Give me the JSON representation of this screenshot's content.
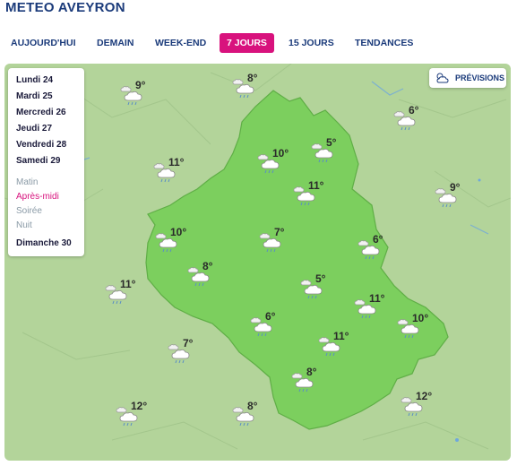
{
  "title": "METEO AVEYRON",
  "tabs": [
    {
      "label": "AUJOURD'HUI",
      "active": false
    },
    {
      "label": "DEMAIN",
      "active": false
    },
    {
      "label": "WEEK-END",
      "active": false
    },
    {
      "label": "7 JOURS",
      "active": true
    },
    {
      "label": "15 JOURS",
      "active": false
    },
    {
      "label": "TENDANCES",
      "active": false
    }
  ],
  "days": [
    {
      "label": "Lundi 24"
    },
    {
      "label": "Mardi 25"
    },
    {
      "label": "Mercredi 26"
    },
    {
      "label": "Jeudi 27"
    },
    {
      "label": "Vendredi 28"
    },
    {
      "label": "Samedi 29"
    },
    {
      "label": "Dimanche 30"
    }
  ],
  "periods": [
    {
      "label": "Matin",
      "active": false
    },
    {
      "label": "Après-midi",
      "active": true
    },
    {
      "label": "Soirée",
      "active": false
    },
    {
      "label": "Nuit",
      "active": false
    }
  ],
  "previsions_label": "PRÉVISIONS",
  "forecasts": [
    {
      "temp": "9°",
      "icon": "rain-cloud-icon"
    },
    {
      "temp": "8°",
      "icon": "rain-cloud-icon"
    },
    {
      "temp": "6°",
      "icon": "rain-cloud-icon"
    },
    {
      "temp": "5°",
      "icon": "rain-cloud-icon"
    },
    {
      "temp": "10°",
      "icon": "rain-cloud-icon"
    },
    {
      "temp": "11°",
      "icon": "rain-cloud-icon"
    },
    {
      "temp": "11°",
      "icon": "rain-cloud-icon"
    },
    {
      "temp": "9°",
      "icon": "rain-cloud-icon"
    },
    {
      "temp": "10°",
      "icon": "rain-cloud-icon"
    },
    {
      "temp": "7°",
      "icon": "rain-cloud-icon"
    },
    {
      "temp": "6°",
      "icon": "rain-cloud-icon"
    },
    {
      "temp": "8°",
      "icon": "rain-cloud-icon"
    },
    {
      "temp": "11°",
      "icon": "rain-cloud-icon"
    },
    {
      "temp": "5°",
      "icon": "rain-cloud-icon"
    },
    {
      "temp": "6°",
      "icon": "rain-cloud-icon"
    },
    {
      "temp": "11°",
      "icon": "rain-cloud-icon"
    },
    {
      "temp": "10°",
      "icon": "rain-cloud-icon"
    },
    {
      "temp": "11°",
      "icon": "rain-cloud-icon"
    },
    {
      "temp": "8°",
      "icon": "rain-cloud-icon"
    },
    {
      "temp": "7°",
      "icon": "rain-cloud-icon"
    },
    {
      "temp": "12°",
      "icon": "rain-cloud-icon"
    },
    {
      "temp": "8°",
      "icon": "rain-cloud-icon"
    },
    {
      "temp": "12°",
      "icon": "rain-cloud-icon"
    }
  ],
  "colors": {
    "accent": "#d8127d",
    "title": "#1a3a7a",
    "map_bg": "#b3d49a",
    "department": "#7ccf5e"
  }
}
